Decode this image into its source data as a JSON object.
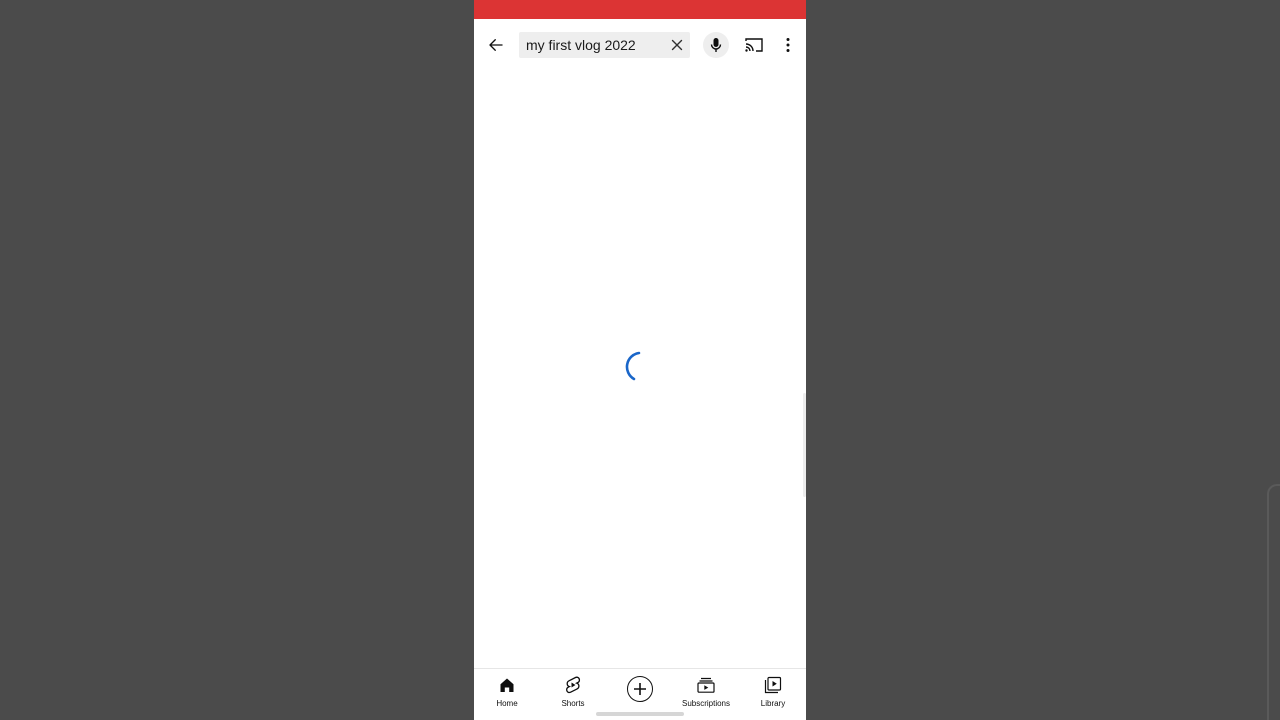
{
  "app": {
    "accent_color": "#dc3434",
    "background_color": "#4b4b4b"
  },
  "top_bar": {
    "back_icon": "arrow-left-icon",
    "search": {
      "value": "my first vlog 2022",
      "clear_icon": "close-icon"
    },
    "mic_icon": "microphone-icon",
    "cast_icon": "cast-icon",
    "more_icon": "more-vertical-icon"
  },
  "content": {
    "state": "loading",
    "spinner_color": "#1a66c9"
  },
  "bottom_nav": {
    "items": [
      {
        "label": "Home",
        "icon": "home-icon",
        "active": true
      },
      {
        "label": "Shorts",
        "icon": "shorts-icon"
      },
      {
        "label": "",
        "icon": "create-plus-icon"
      },
      {
        "label": "Subscriptions",
        "icon": "subscriptions-icon"
      },
      {
        "label": "Library",
        "icon": "library-icon"
      }
    ]
  }
}
